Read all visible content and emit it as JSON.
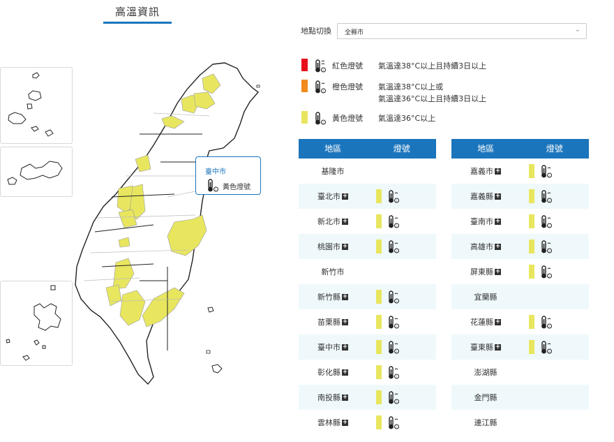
{
  "header": {
    "title": "高溫資訊"
  },
  "location": {
    "label": "地點切換",
    "selected": "全縣市"
  },
  "legend": [
    {
      "name": "紅色燈號",
      "desc1": "氣溫達38°C以上且持續3日以上",
      "desc2": "",
      "color": "#e8101a"
    },
    {
      "name": "橙色燈號",
      "desc1": "氣溫達38°C以上或",
      "desc2": "氣溫達36°C以上且持續3日以上",
      "color": "#f28a1c"
    },
    {
      "name": "黃色燈號",
      "desc1": "氣溫達36°C以上",
      "desc2": "",
      "color": "#e8e65f"
    }
  ],
  "tooltip": {
    "city": "臺中市",
    "signal": "黃色燈號"
  },
  "table": {
    "col_region": "地區",
    "col_signal": "燈號",
    "left": [
      {
        "name": "基隆市",
        "expand": false,
        "yellow": false
      },
      {
        "name": "臺北市",
        "expand": true,
        "yellow": true
      },
      {
        "name": "新北市",
        "expand": true,
        "yellow": true
      },
      {
        "name": "桃園市",
        "expand": true,
        "yellow": true
      },
      {
        "name": "新竹市",
        "expand": false,
        "yellow": false
      },
      {
        "name": "新竹縣",
        "expand": true,
        "yellow": true
      },
      {
        "name": "苗栗縣",
        "expand": true,
        "yellow": true
      },
      {
        "name": "臺中市",
        "expand": true,
        "yellow": true
      },
      {
        "name": "彰化縣",
        "expand": true,
        "yellow": true
      },
      {
        "name": "南投縣",
        "expand": true,
        "yellow": true
      },
      {
        "name": "雲林縣",
        "expand": true,
        "yellow": true
      }
    ],
    "right": [
      {
        "name": "嘉義市",
        "expand": true,
        "yellow": true
      },
      {
        "name": "嘉義縣",
        "expand": true,
        "yellow": true
      },
      {
        "name": "臺南市",
        "expand": true,
        "yellow": true
      },
      {
        "name": "高雄市",
        "expand": true,
        "yellow": true
      },
      {
        "name": "屏東縣",
        "expand": true,
        "yellow": true
      },
      {
        "name": "宜蘭縣",
        "expand": false,
        "yellow": false
      },
      {
        "name": "花蓮縣",
        "expand": true,
        "yellow": true
      },
      {
        "name": "臺東縣",
        "expand": true,
        "yellow": true
      },
      {
        "name": "澎湖縣",
        "expand": false,
        "yellow": false
      },
      {
        "name": "金門縣",
        "expand": false,
        "yellow": false
      },
      {
        "name": "連江縣",
        "expand": false,
        "yellow": false
      }
    ]
  }
}
